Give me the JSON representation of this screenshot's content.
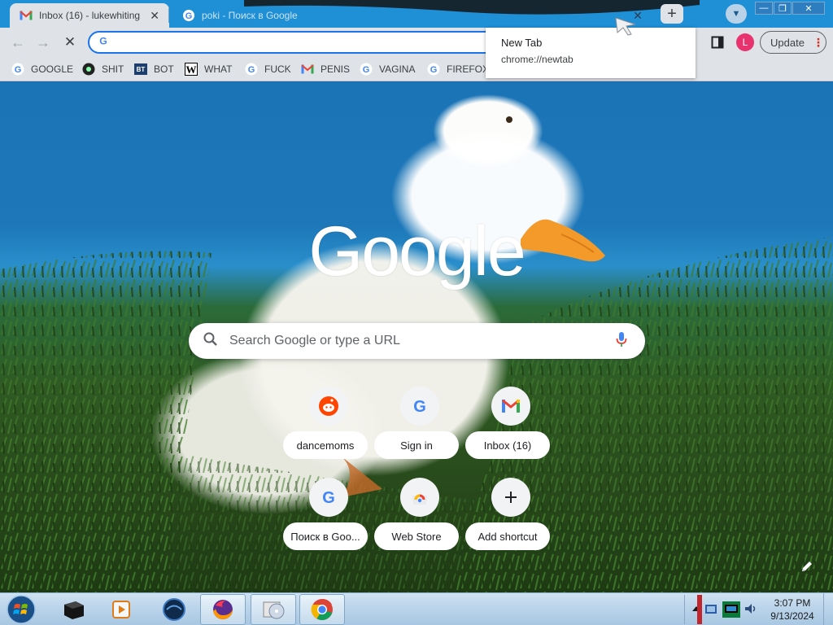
{
  "tabs": [
    {
      "title": "Inbox (16) - lukewhiting",
      "icon": "gmail-icon",
      "active": true
    },
    {
      "title": "poki - Поиск в Google",
      "icon": "google-icon",
      "active": false
    }
  ],
  "new_tab_button": "+",
  "window_controls": {
    "minimize": "—",
    "maximize": "❐",
    "close": "✕"
  },
  "toolbar": {
    "back": "←",
    "forward": "→",
    "stop": "✕",
    "omnibox_value": "",
    "profile_initial": "L",
    "update_label": "Update",
    "menu": "⋮"
  },
  "tooltip": {
    "title": "New Tab",
    "url": "chrome://newtab"
  },
  "bookmarks": [
    {
      "label": "GOOGLE",
      "icon": "google-icon"
    },
    {
      "label": "SHIT",
      "icon": "shit-icon"
    },
    {
      "label": "BOT",
      "icon": "bt-icon"
    },
    {
      "label": "WHAT",
      "icon": "w-icon"
    },
    {
      "label": "FUCK",
      "icon": "google-icon"
    },
    {
      "label": "PENIS",
      "icon": "gmail-icon"
    },
    {
      "label": "VAGINA",
      "icon": "google-icon"
    },
    {
      "label": "FIREFOX",
      "icon": "google-icon"
    }
  ],
  "ntp": {
    "logo": "Google",
    "search_placeholder": "Search Google or type a URL",
    "shortcuts": [
      {
        "label": "dancemoms",
        "icon": "reddit-icon"
      },
      {
        "label": "Sign in",
        "icon": "google-icon"
      },
      {
        "label": "Inbox (16)",
        "icon": "gmail-icon"
      },
      {
        "label": "Поиск в Goo...",
        "icon": "google-icon"
      },
      {
        "label": "Web Store",
        "icon": "webstore-icon"
      },
      {
        "label": "Add shortcut",
        "icon": "plus-icon"
      }
    ]
  },
  "taskbar": {
    "clock_time": "3:07 PM",
    "clock_date": "9/13/2024"
  },
  "colors": {
    "tab_strip": "#1f8fd6",
    "toolbar": "#dfe3e8",
    "focus_ring": "#1a73e8",
    "avatar": "#e8336e",
    "beak": "#f39a2b"
  }
}
